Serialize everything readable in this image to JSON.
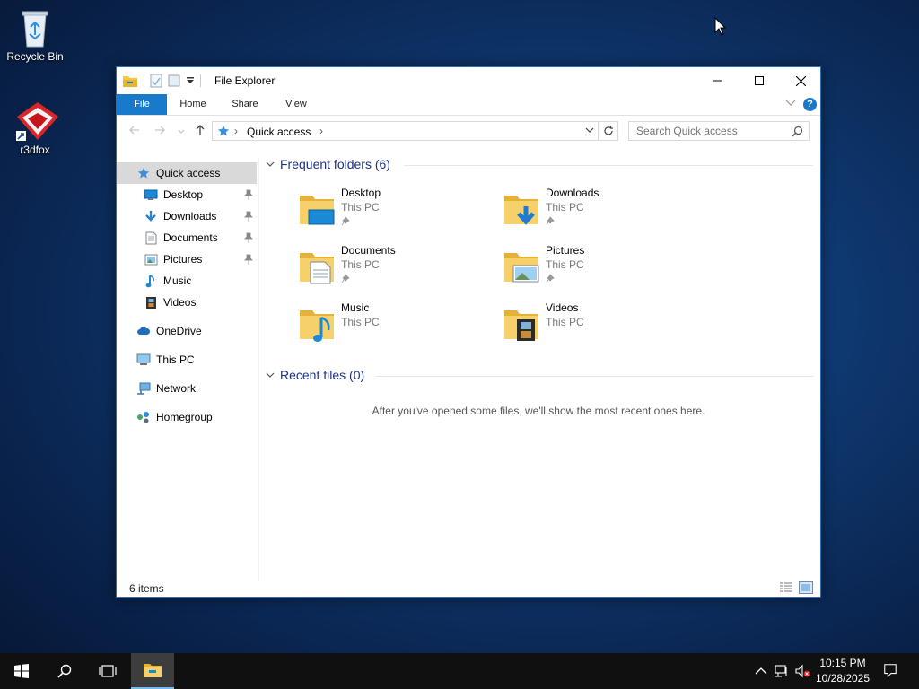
{
  "desktop": {
    "icons": [
      {
        "label": "Recycle Bin"
      },
      {
        "label": "r3dfox"
      }
    ]
  },
  "window": {
    "title": "File Explorer",
    "ribbon_tabs": [
      "File",
      "Home",
      "Share",
      "View"
    ],
    "help_label": "?",
    "address": {
      "crumb": "Quick access"
    },
    "search": {
      "placeholder": "Search Quick access"
    },
    "sidebar": {
      "items": [
        {
          "label": "Quick access",
          "icon": "star-icon",
          "selected": true
        },
        {
          "label": "Desktop",
          "icon": "desktop-icon",
          "pinned": true
        },
        {
          "label": "Downloads",
          "icon": "download-arrow-icon",
          "pinned": true
        },
        {
          "label": "Documents",
          "icon": "document-icon",
          "pinned": true
        },
        {
          "label": "Pictures",
          "icon": "picture-icon",
          "pinned": true
        },
        {
          "label": "Music",
          "icon": "music-note-icon"
        },
        {
          "label": "Videos",
          "icon": "film-icon"
        },
        {
          "label": "OneDrive",
          "icon": "cloud-icon"
        },
        {
          "label": "This PC",
          "icon": "computer-icon"
        },
        {
          "label": "Network",
          "icon": "network-icon"
        },
        {
          "label": "Homegroup",
          "icon": "homegroup-icon"
        }
      ]
    },
    "frequent": {
      "header": "Frequent folders (6)",
      "folders": [
        {
          "name": "Desktop",
          "location": "This PC",
          "pinned": true
        },
        {
          "name": "Downloads",
          "location": "This PC",
          "pinned": true
        },
        {
          "name": "Documents",
          "location": "This PC",
          "pinned": true
        },
        {
          "name": "Pictures",
          "location": "This PC",
          "pinned": true
        },
        {
          "name": "Music",
          "location": "This PC",
          "pinned": false
        },
        {
          "name": "Videos",
          "location": "This PC",
          "pinned": false
        }
      ]
    },
    "recent": {
      "header": "Recent files (0)",
      "empty_message": "After you've opened some files, we'll show the most recent ones here."
    },
    "status": {
      "text": "6 items"
    }
  },
  "taskbar": {
    "clock": {
      "time": "10:15 PM",
      "date": "10/28/2025"
    }
  },
  "colors": {
    "accent": "#1979ca",
    "group_header": "#1e3287",
    "folder_yellow": "#f5c842",
    "selection": "#d9d9d9"
  }
}
